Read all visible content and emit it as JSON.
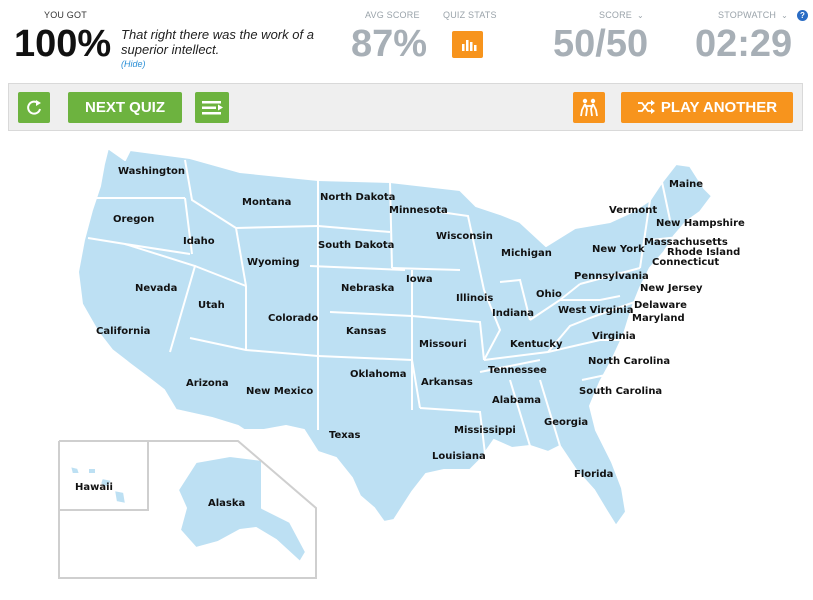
{
  "result": {
    "label": "YOU GOT",
    "percent": "100%",
    "message": "That right there was the work of a superior intellect.",
    "hide_link": "(Hide)"
  },
  "avg_score": {
    "label": "AVG SCORE",
    "value": "87%"
  },
  "quiz_stats": {
    "label": "QUIZ STATS",
    "icon": "bar-chart-icon"
  },
  "score": {
    "label": "SCORE",
    "value": "50/50"
  },
  "stopwatch": {
    "label": "STOPWATCH",
    "value": "02:29"
  },
  "help": {
    "icon": "question-icon",
    "glyph": "?"
  },
  "toolbar": {
    "restart_icon": "restart-icon",
    "next_quiz_label": "NEXT QUIZ",
    "playlist_icon": "playlist-icon",
    "challenge_icon": "challenge-icon",
    "play_another_label": "PLAY ANOTHER",
    "shuffle_icon": "shuffle-icon"
  },
  "colors": {
    "green": "#6db33f",
    "orange": "#f7941d",
    "map_fill": "#bde0f3",
    "link": "#2a8fd6"
  },
  "map": {
    "states": [
      "Washington",
      "Oregon",
      "California",
      "Idaho",
      "Nevada",
      "Montana",
      "Wyoming",
      "Utah",
      "Arizona",
      "Colorado",
      "New Mexico",
      "North Dakota",
      "South Dakota",
      "Nebraska",
      "Kansas",
      "Oklahoma",
      "Texas",
      "Minnesota",
      "Iowa",
      "Missouri",
      "Arkansas",
      "Louisiana",
      "Wisconsin",
      "Illinois",
      "Mississippi",
      "Michigan",
      "Indiana",
      "Kentucky",
      "Tennessee",
      "Alabama",
      "Ohio",
      "Georgia",
      "Florida",
      "South Carolina",
      "North Carolina",
      "Virginia",
      "West Virginia",
      "Pennsylvania",
      "Maryland",
      "Delaware",
      "New Jersey",
      "New York",
      "Connecticut",
      "Rhode Island",
      "Massachusetts",
      "Vermont",
      "New Hampshire",
      "Maine",
      "Alaska",
      "Hawaii"
    ]
  }
}
